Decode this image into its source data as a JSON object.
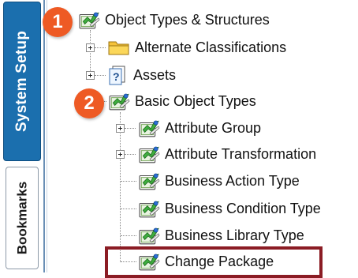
{
  "tabs": {
    "system_setup": "System Setup",
    "bookmarks": "Bookmarks"
  },
  "badges": [
    "1",
    "2"
  ],
  "tree": {
    "root": {
      "label": "Object Types & Structures",
      "icon": "object-type-icon"
    },
    "alternate": {
      "label": "Alternate Classifications",
      "icon": "folder-icon"
    },
    "assets": {
      "label": "Assets",
      "icon": "asset-document-icon"
    },
    "basic": {
      "label": "Basic Object Types",
      "icon": "object-type-icon"
    },
    "children": [
      {
        "label": "Attribute Group",
        "expandable": true
      },
      {
        "label": "Attribute Transformation",
        "expandable": true
      },
      {
        "label": "Business Action Type",
        "expandable": false
      },
      {
        "label": "Business Condition Type",
        "expandable": false
      },
      {
        "label": "Business Library Type",
        "expandable": false
      },
      {
        "label": "Change Package",
        "expandable": false,
        "highlighted": true
      }
    ]
  },
  "colors": {
    "tab_active": "#1b6fae",
    "badge": "#ee5a24",
    "highlight_border": "#8b1c24",
    "folder": "#f5c23a"
  }
}
